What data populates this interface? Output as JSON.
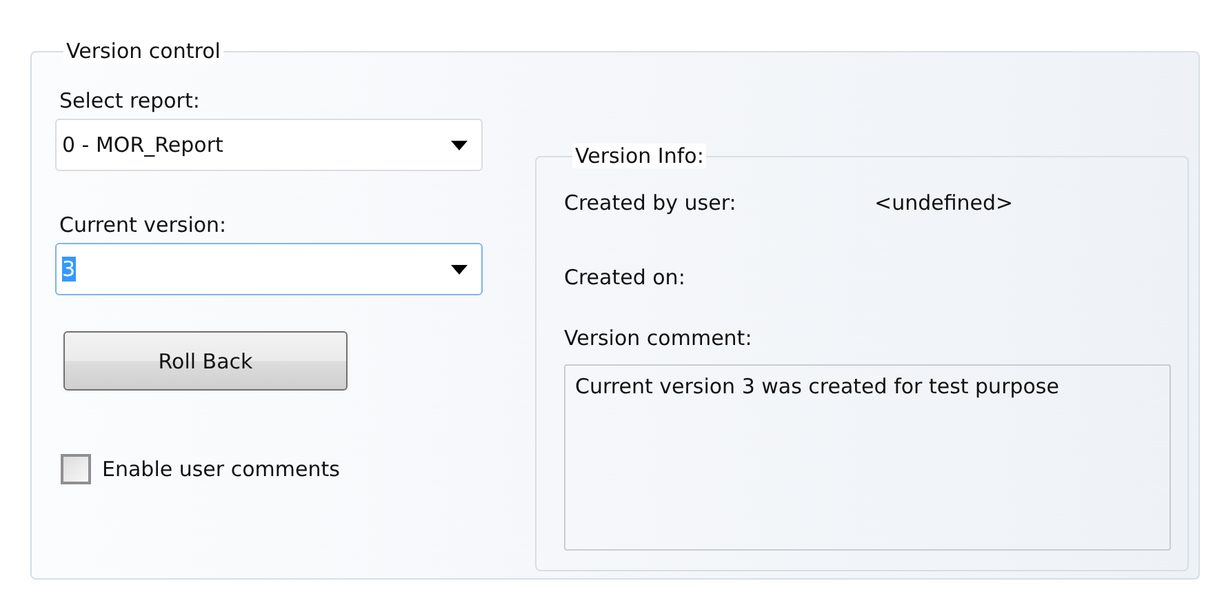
{
  "group": {
    "title": "Version control"
  },
  "report": {
    "label": "Select report:",
    "value": "0 - MOR_Report",
    "focused": false
  },
  "version": {
    "label": "Current version:",
    "value": "3",
    "focused": true,
    "text_selected": true
  },
  "rollback_button": {
    "label": "Roll Back"
  },
  "enable_comments": {
    "label": "Enable user comments",
    "checked": false
  },
  "info": {
    "title": "Version Info:",
    "rows": [
      {
        "label": "Created by user:",
        "value": "<undefined>"
      },
      {
        "label": "Created on:"
      }
    ],
    "comment_label": "Version comment:",
    "comment": "Current version 3 was created for test purpose"
  }
}
